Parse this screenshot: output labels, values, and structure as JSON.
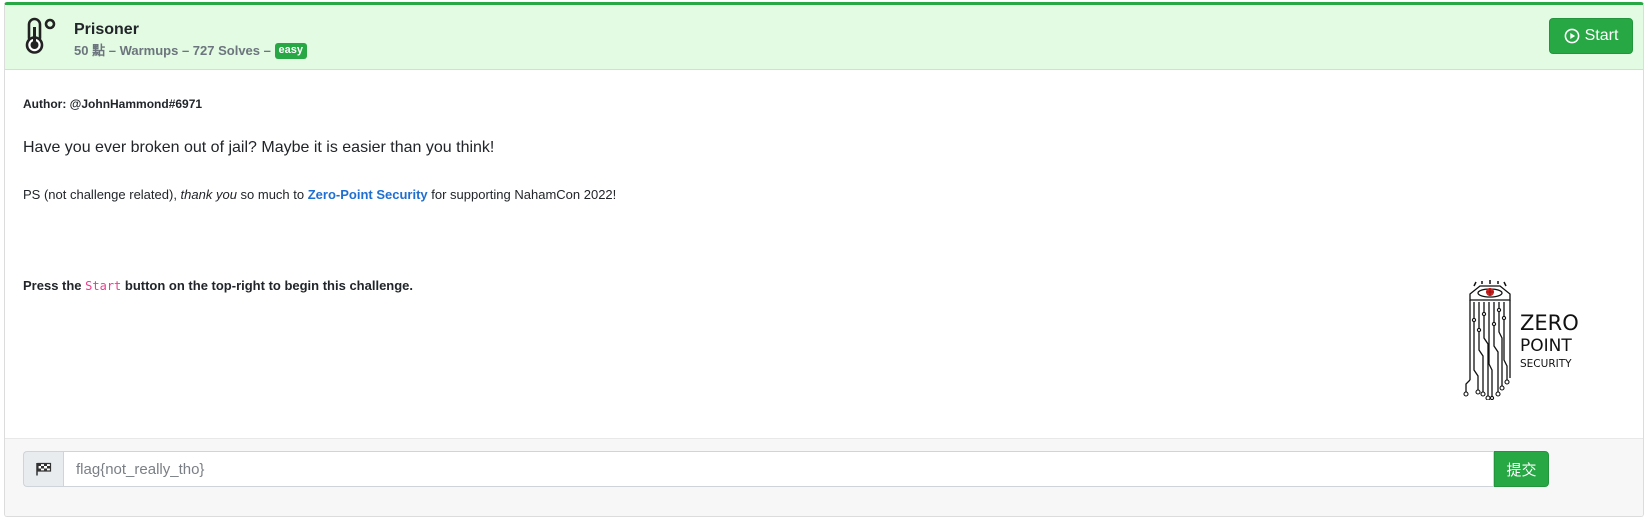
{
  "header": {
    "title": "Prisoner",
    "points": "50 點",
    "separator": "–",
    "category": "Warmups",
    "solves": "727 Solves",
    "difficulty": "easy",
    "start_label": "Start",
    "accent_color": "#28a745",
    "header_bg": "#e2fbe2",
    "icon": "thermometer-icon"
  },
  "body": {
    "author": "Author: @JohnHammond#6971",
    "lead": "Have you ever broken out of jail? Maybe it is easier than you think!",
    "ps_prefix": "PS (not challenge related), ",
    "ps_em": "thank you",
    "ps_middle": " so much to ",
    "ps_link": "Zero-Point Security",
    "ps_suffix": " for supporting NahamCon 2022!",
    "press_prefix": "Press the ",
    "press_code": "Start",
    "press_suffix": " button on the top-right to begin this challenge.",
    "logo": {
      "line1": "ZERO",
      "line2": "POINT",
      "line3": "SECURITY"
    }
  },
  "footer": {
    "flag_icon": "checkered-flag-icon",
    "placeholder": "flag{not_really_tho}",
    "value": "",
    "submit_label": "提交"
  }
}
